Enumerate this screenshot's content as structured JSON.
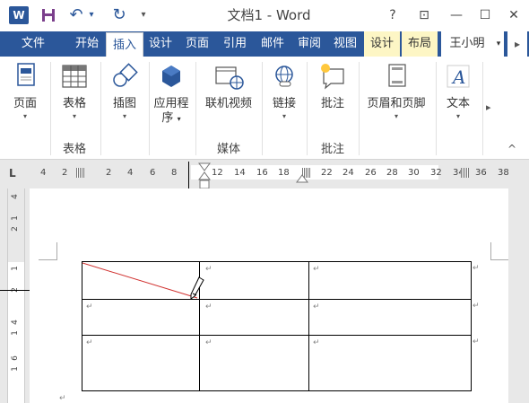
{
  "titlebar": {
    "title": "文档1 - Word",
    "help": "?",
    "ribbon_display": "⊡",
    "minimize": "—",
    "maximize": "☐",
    "close": "✕",
    "undo_arrow": "↶",
    "undo_dd": "▾",
    "redo": "↻"
  },
  "tabs": {
    "file": "文件",
    "home": "开始",
    "insert": "插入",
    "design": "设计",
    "layout": "页面",
    "references": "引用",
    "mailings": "邮件",
    "review": "审阅",
    "view": "视图",
    "table_design": "设计",
    "table_layout": "布局",
    "user": "王小明",
    "user_dd": "▾"
  },
  "ribbon": {
    "pages": "页面",
    "table": "表格",
    "illustrations": "插图",
    "apps": "应用程",
    "apps2": "序",
    "online_video": "联机视频",
    "links": "链接",
    "comment": "批注",
    "header_footer": "页眉和页脚",
    "text": "文本",
    "group_tables": "表格",
    "group_media": "媒体",
    "group_comments": "批注",
    "dropdown": "▾",
    "scroll_right": "▸",
    "collapse": "^"
  },
  "ruler": {
    "marker": "L",
    "ticks": [
      "4",
      "2",
      "2",
      "4",
      "6",
      "8",
      "12",
      "14",
      "16",
      "18",
      "22",
      "24",
      "26",
      "28",
      "30",
      "32",
      "34",
      "36",
      "38"
    ],
    "vticks": [
      "4",
      "2",
      "2",
      "4",
      "6"
    ],
    "vticks2": [
      "1",
      "1",
      "1",
      "1"
    ]
  },
  "document": {
    "paragraph_mark": "↵",
    "table": {
      "rows": 3,
      "cols": 3
    }
  }
}
